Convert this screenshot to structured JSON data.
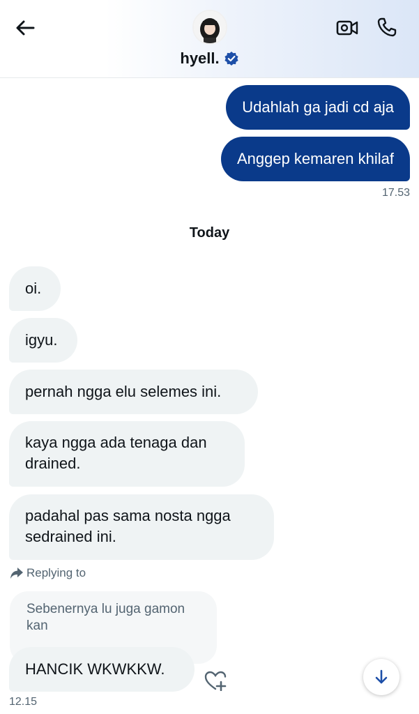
{
  "header": {
    "name": "hyell.",
    "back_icon": "arrow-left-icon",
    "video_icon": "video-camera-icon",
    "call_icon": "phone-icon",
    "verified_icon": "verified-badge-icon",
    "verified_color": "#1d9bf0"
  },
  "messages_out": [
    {
      "text": "Udahlah ga jadi cd aja"
    },
    {
      "text": "Anggep kemaren khilaf"
    }
  ],
  "out_time": "17.53",
  "day_separator": "Today",
  "messages_in": [
    {
      "text": "oi."
    },
    {
      "text": "igyu."
    },
    {
      "text": "pernah ngga elu selemes ini."
    },
    {
      "line1": "kaya ngga ada tenaga dan",
      "line2": "drained."
    },
    {
      "line1": "padahal pas sama nosta ngga",
      "line2": "sedrained ini."
    }
  ],
  "reply": {
    "label": "Replying to",
    "quoted_line1": "Sebenernya lu juga gamon",
    "quoted_line2": "kan",
    "message": "HANCIK WKWKKW.",
    "time": "12.15"
  },
  "colors": {
    "outgoing_bubble": "#0a3a8a",
    "incoming_bubble": "#eff3f4",
    "accent": "#1d9bf0"
  }
}
